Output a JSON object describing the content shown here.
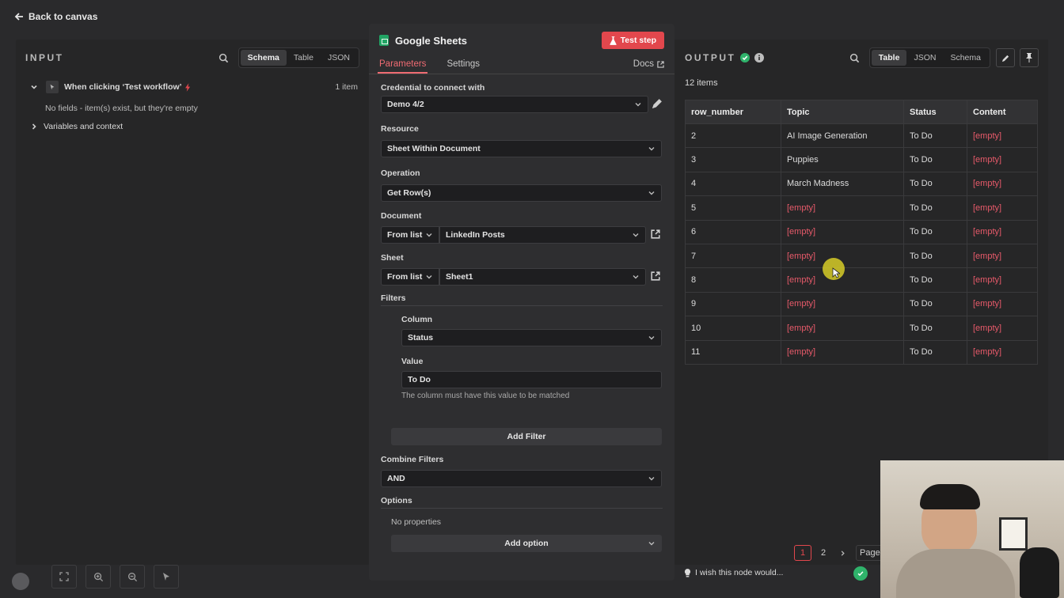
{
  "topbar": {
    "back_label": "Back to canvas"
  },
  "input": {
    "title": "INPUT",
    "view_tabs": [
      "Schema",
      "Table",
      "JSON"
    ],
    "active_view": "Schema",
    "trigger_label": "When clicking ‘Test workflow’",
    "trigger_count": "1 item",
    "empty_message": "No fields - item(s) exist, but they're empty",
    "variables_label": "Variables and context"
  },
  "node": {
    "title": "Google Sheets",
    "test_button": "Test step",
    "tabs": [
      "Parameters",
      "Settings"
    ],
    "active_tab": "Parameters",
    "docs_label": "Docs",
    "credential_label": "Credential to connect with",
    "credential_value": "Demo 4/2",
    "resource_label": "Resource",
    "resource_value": "Sheet Within Document",
    "operation_label": "Operation",
    "operation_value": "Get Row(s)",
    "document_label": "Document",
    "document_mode": "From list",
    "document_value": "LinkedIn Posts",
    "sheet_label": "Sheet",
    "sheet_mode": "From list",
    "sheet_value": "Sheet1",
    "filters_label": "Filters",
    "column_label": "Column",
    "column_value": "Status",
    "value_label": "Value",
    "value_value": "To Do",
    "value_hint": "The column must have this value to be matched",
    "add_filter": "Add Filter",
    "combine_label": "Combine Filters",
    "combine_value": "AND",
    "options_label": "Options",
    "no_properties": "No properties",
    "add_option": "Add option"
  },
  "output": {
    "title": "OUTPUT",
    "view_tabs": [
      "Table",
      "JSON",
      "Schema"
    ],
    "active_view": "Table",
    "items_count": "12 items",
    "columns": [
      "row_number",
      "Topic",
      "Status",
      "Content"
    ],
    "rows": [
      [
        "2",
        "AI Image Generation",
        "To Do",
        "[empty]"
      ],
      [
        "3",
        "Puppies",
        "To Do",
        "[empty]"
      ],
      [
        "4",
        "March Madness",
        "To Do",
        "[empty]"
      ],
      [
        "5",
        "[empty]",
        "To Do",
        "[empty]"
      ],
      [
        "6",
        "[empty]",
        "To Do",
        "[empty]"
      ],
      [
        "7",
        "[empty]",
        "To Do",
        "[empty]"
      ],
      [
        "8",
        "[empty]",
        "To Do",
        "[empty]"
      ],
      [
        "9",
        "[empty]",
        "To Do",
        "[empty]"
      ],
      [
        "10",
        "[empty]",
        "To Do",
        "[empty]"
      ],
      [
        "11",
        "[empty]",
        "To Do",
        "[empty]"
      ]
    ],
    "pages": [
      "1",
      "2"
    ],
    "active_page": "1",
    "page_label": "Page"
  },
  "footer": {
    "wish_text": "I wish this node would..."
  },
  "colors": {
    "accent": "#e2474d",
    "empty_text": "#e85a6a",
    "success": "#2fb36b",
    "sheets_green": "#21a464"
  }
}
